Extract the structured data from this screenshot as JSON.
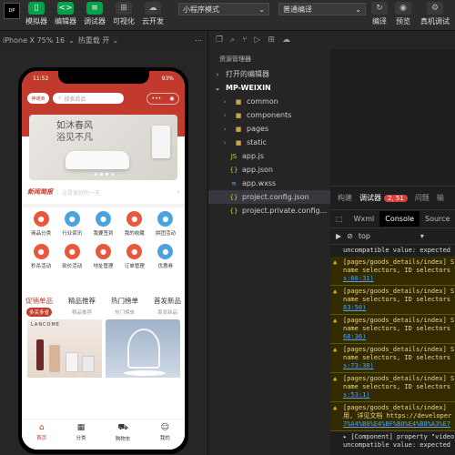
{
  "toolbar": {
    "avatar_initials": "DP",
    "simulator": "模拟器",
    "editor": "编辑器",
    "debugger": "调试器",
    "visualize": "可视化",
    "cloud": "云开发",
    "mode_select": "小程序模式",
    "compile_select": "普通编译",
    "compile": "编译",
    "preview": "预览",
    "real_debug": "真机调试"
  },
  "simbar": {
    "device": "iPhone X 75% 16",
    "hot_reload": "热重载 开"
  },
  "phone": {
    "time": "11:52",
    "battery": "93%",
    "logo": "神通商",
    "search_placeholder": "搜索商品",
    "banner_line1": "如沐春风",
    "banner_line2": "浴见不凡",
    "news_tag": "新闻简报",
    "news_text": "这是美好的一天",
    "grid": [
      {
        "label": "商品分类",
        "color": "#e9573f"
      },
      {
        "label": "行业资讯",
        "color": "#4aa3df"
      },
      {
        "label": "我要签到",
        "color": "#4aa3df"
      },
      {
        "label": "我的收藏",
        "color": "#e9573f"
      },
      {
        "label": "拼团活动",
        "color": "#4aa3df"
      },
      {
        "label": "秒杀活动",
        "color": "#e9573f"
      },
      {
        "label": "砍价活动",
        "color": "#e9573f"
      },
      {
        "label": "地址管理",
        "color": "#e9573f"
      },
      {
        "label": "订单管理",
        "color": "#e9573f"
      },
      {
        "label": "优惠券",
        "color": "#4aa3df"
      }
    ],
    "tabs": [
      {
        "title": "促销单品",
        "sub": "多买多省"
      },
      {
        "title": "精品推荐",
        "sub": "精品推荐"
      },
      {
        "title": "热门榜单",
        "sub": "热门榜单"
      },
      {
        "title": "首发新品",
        "sub": "首发新品"
      }
    ],
    "prod1_brand": "LANCOME",
    "tabbar": [
      {
        "label": "首页",
        "icon": "⌂"
      },
      {
        "label": "分类",
        "icon": "▦"
      },
      {
        "label": "购物车",
        "icon": "⛟"
      },
      {
        "label": "我的",
        "icon": "☺"
      }
    ]
  },
  "explorer": {
    "title": "资源管理器",
    "open_editors": "打开的编辑器",
    "project": "MP-WEIXIN",
    "items": [
      {
        "name": "common",
        "type": "folder",
        "icon": "▸"
      },
      {
        "name": "components",
        "type": "folder",
        "icon": "▸"
      },
      {
        "name": "pages",
        "type": "folder",
        "icon": "▸"
      },
      {
        "name": "static",
        "type": "folder",
        "icon": "▸"
      },
      {
        "name": "app.js",
        "type": "js",
        "icon": "JS"
      },
      {
        "name": "app.json",
        "type": "json",
        "icon": "{}"
      },
      {
        "name": "app.wxss",
        "type": "wxss",
        "icon": "≋"
      },
      {
        "name": "project.config.json",
        "type": "json",
        "icon": "{}"
      },
      {
        "name": "project.private.config...",
        "type": "json",
        "icon": "{}"
      }
    ]
  },
  "panel": {
    "tab_build": "构建",
    "tab_debugger": "调试器",
    "badge": "2, 51",
    "tab_issues": "问题",
    "tab_output": "输",
    "subtab_wxml": "Wxml",
    "subtab_console": "Console",
    "subtab_sources": "Source",
    "filter_context": "top",
    "logs": [
      {
        "kind": "plain",
        "lines": [
          "uncompatible value: expected"
        ]
      },
      {
        "kind": "warn",
        "lines": [
          "[pages/goods_details/index] S",
          "name selectors, ID selectors"
        ],
        "link": "s:66:31)"
      },
      {
        "kind": "warn",
        "lines": [
          "[pages/goods_details/index] S",
          "name selectors, ID selectors"
        ],
        "link": "83:50)"
      },
      {
        "kind": "warn",
        "lines": [
          "[pages/goods_details/index] S",
          "name selectors, ID selectors"
        ],
        "link": "68:36)"
      },
      {
        "kind": "warn",
        "lines": [
          "[pages/goods_details/index] S",
          "name selectors, ID selectors"
        ],
        "link": "s:73:30)"
      },
      {
        "kind": "warn",
        "lines": [
          "[pages/goods_details/index] S",
          "name selectors, ID selectors"
        ],
        "link": "s:53:1)"
      },
      {
        "kind": "warn",
        "lines": [
          "[pages/goods_details/index]",
          "用, 详见文档 https://developer"
        ],
        "link": "7%A4%B0%E4%BF%B0%E4%B8%A3%E7"
      },
      {
        "kind": "info",
        "lines": [
          "▸ [Component] property \"video",
          "uncompatible value: expected"
        ]
      }
    ]
  },
  "colors": {
    "accent": "#c23a2c",
    "green": "#06a14a"
  }
}
